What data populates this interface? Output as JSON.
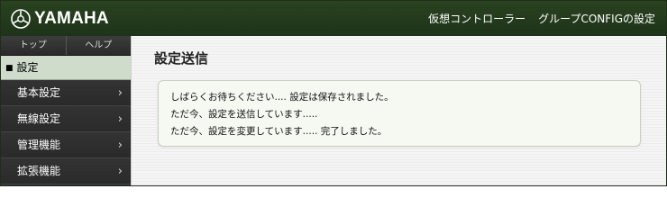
{
  "header": {
    "logo_text": "YAMAHA",
    "title_part1": "仮想コントローラー",
    "title_part2": "グループCONFIGの設定"
  },
  "sidebar": {
    "tabs": [
      {
        "label": "トップ"
      },
      {
        "label": "ヘルプ"
      }
    ],
    "active_marker": "■",
    "active_label": "設定",
    "items": [
      {
        "label": "基本設定"
      },
      {
        "label": "無線設定"
      },
      {
        "label": "管理機能"
      },
      {
        "label": "拡張機能"
      }
    ],
    "chevron": "›"
  },
  "main": {
    "title": "設定送信",
    "messages": [
      "しばらくお待ちください.... 設定は保存されました。",
      "ただ今、設定を送信しています.....",
      "ただ今、設定を変更しています..... 完了しました。"
    ]
  },
  "colors": {
    "header_bg": "#1e331a",
    "sidebar_bg": "#2c2c2c",
    "active_bg": "#cfdccb",
    "message_bg": "#f6f8f2"
  }
}
